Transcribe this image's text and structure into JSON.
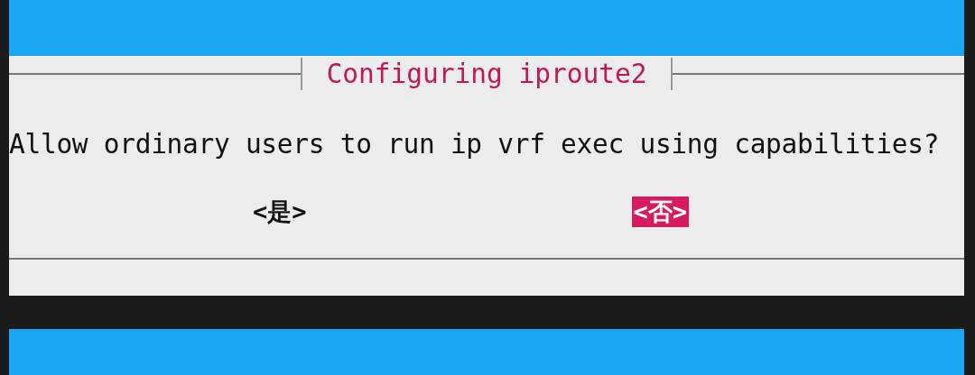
{
  "dialog": {
    "title": "Configuring iproute2",
    "question": "Allow ordinary users to run ip vrf exec using capabilities?",
    "buttons": [
      {
        "label": "<是>",
        "selected": false
      },
      {
        "label": "<否>",
        "selected": true
      }
    ]
  }
}
